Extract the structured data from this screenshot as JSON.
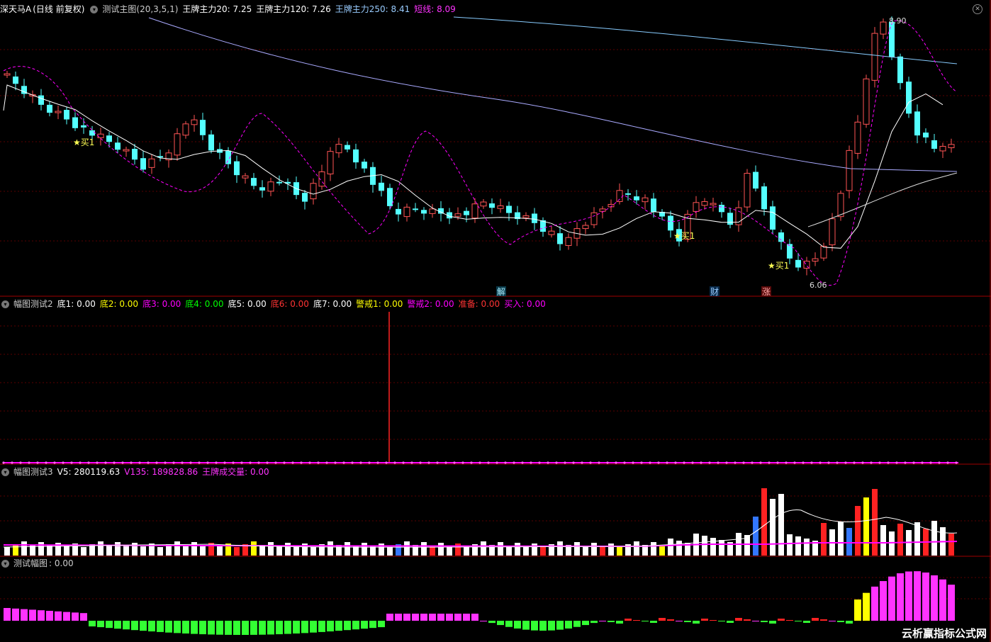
{
  "main": {
    "stock": "深天马A",
    "period": "(日线 前复权)",
    "indicator": "测试主图(20,3,5,1)",
    "ma20_label": "王牌主力20: 7.25",
    "ma120_label": "王牌主力120: 7.26",
    "ma250_label": "王牌主力250: 8.41",
    "short_label": "短线: 8.09",
    "high_label": "8.90",
    "low_label": "6.06",
    "buy_label": "★买1",
    "event_jie": "解",
    "event_cai": "财",
    "event_zhang": "涨",
    "colors": {
      "up": "#ff5555",
      "down": "#54ffff",
      "ma20": "#ffffff",
      "ma120": "#aaaaff",
      "ma250": "#88ccff",
      "short": "#ff00ff"
    }
  },
  "panel2": {
    "name": "幅图测试2",
    "items": [
      {
        "label": "底1: 0.00",
        "color": "#ffffff"
      },
      {
        "label": "底2: 0.00",
        "color": "#ffff00"
      },
      {
        "label": "底3: 0.00",
        "color": "#ff00ff"
      },
      {
        "label": "底4: 0.00",
        "color": "#00ff00"
      },
      {
        "label": "底5: 0.00",
        "color": "#ffffff"
      },
      {
        "label": "底6: 0.00",
        "color": "#ff3333"
      },
      {
        "label": "底7: 0.00",
        "color": "#ffffff"
      },
      {
        "label": "警戒1: 0.00",
        "color": "#ffff00"
      },
      {
        "label": "警戒2: 0.00",
        "color": "#ff00ff"
      },
      {
        "label": "准备: 0.00",
        "color": "#ff3333"
      },
      {
        "label": "买入: 0.00",
        "color": "#ff00ff"
      }
    ]
  },
  "panel3": {
    "name": "幅图测试3",
    "v5": "V5: 280119.63",
    "v135": "V135: 189828.86",
    "wp": "王牌成交量: 0.00"
  },
  "panel4": {
    "name": "测试幅图",
    "value": ": 0.00"
  },
  "watermark": "云析赢指标公式网"
}
